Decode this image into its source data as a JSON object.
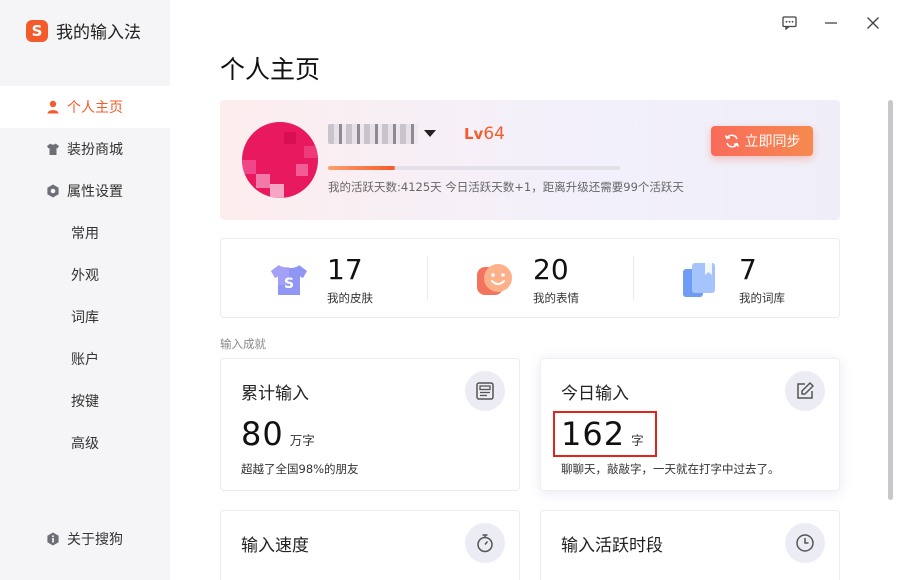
{
  "app": {
    "title": "我的输入法",
    "logo_letter": "S"
  },
  "sidebar": {
    "items": [
      {
        "label": "个人主页",
        "icon": "user-icon",
        "active": true
      },
      {
        "label": "装扮商城",
        "icon": "shirt-icon"
      },
      {
        "label": "属性设置",
        "icon": "gear-icon"
      }
    ],
    "sub_items": [
      "常用",
      "外观",
      "词库",
      "账户",
      "按键",
      "高级"
    ],
    "about": {
      "label": "关于搜狗",
      "icon": "info-icon"
    }
  },
  "window_controls": [
    "feedback-icon",
    "minimize-icon",
    "close-icon"
  ],
  "page": {
    "title": "个人主页"
  },
  "profile": {
    "level_prefix": "Lv",
    "level": "64",
    "progress_fraction": 0.23,
    "progress_text": "我的活跃天数:4125天 今日活跃天数+1，距离升级还需要99个活跃天",
    "sync_label": "立即同步"
  },
  "stats": [
    {
      "value": "17",
      "label": "我的皮肤",
      "icon": "skin-icon"
    },
    {
      "value": "20",
      "label": "我的表情",
      "icon": "emoji-icon"
    },
    {
      "value": "7",
      "label": "我的词库",
      "icon": "dictionary-icon"
    }
  ],
  "achievements": {
    "section_label": "输入成就",
    "cards": [
      {
        "title": "累计输入",
        "value": "80",
        "unit": "万字",
        "desc": "超越了全国98%的朋友",
        "icon": "document-icon"
      },
      {
        "title": "今日输入",
        "value": "162",
        "unit": "字",
        "desc": "聊聊天，敲敲字，一天就在打字中过去了。",
        "icon": "edit-icon"
      },
      {
        "title": "输入速度",
        "icon": "stopwatch-icon"
      },
      {
        "title": "输入活跃时段",
        "icon": "clock-icon"
      }
    ]
  },
  "colors": {
    "accent": "#f45b2a",
    "highlight": "#e0251f"
  }
}
